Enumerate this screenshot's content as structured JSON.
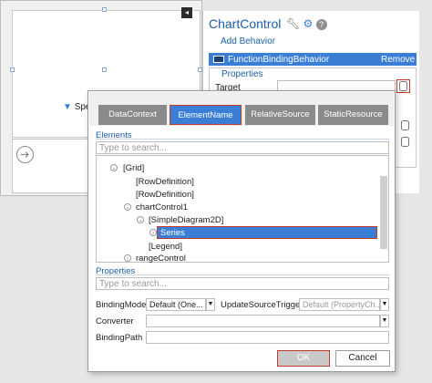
{
  "designer": {
    "legend_label": "Spec",
    "smart_tag_glyph": "◂"
  },
  "panel": {
    "title": "ChartControl",
    "icons": [
      "wrench-icon",
      "gear-icon",
      "help-icon"
    ],
    "help_glyph": "?",
    "add_behavior": "Add Behavior",
    "behavior_name": "FunctionBindingBehavior",
    "remove": "Remove",
    "properties_title": "Properties",
    "target_label": "Target"
  },
  "dialog": {
    "tabs": [
      "DataContext",
      "ElementName",
      "RelativeSource Self",
      "StaticResource"
    ],
    "active_tab": "ElementName",
    "elements_title": "Elements",
    "search_placeholder": "Type to search...",
    "tree": [
      {
        "label": "[Grid]",
        "expander": true
      },
      {
        "label": "[RowDefinition]",
        "expander": false
      },
      {
        "label": "[RowDefinition]",
        "expander": false
      },
      {
        "label": "chartControl1",
        "expander": true
      },
      {
        "label": "[SimpleDiagram2D]",
        "expander": true
      },
      {
        "label": "Series",
        "expander": true,
        "selected": true
      },
      {
        "label": "[Legend]",
        "expander": false
      },
      {
        "label": "rangeControl",
        "expander": true
      }
    ],
    "properties_title": "Properties",
    "props_search_placeholder": "Type to search...",
    "binding_mode_label": "BindingMode",
    "binding_mode_value": "Default (One...",
    "update_trigger_label": "UpdateSourceTrigger",
    "update_trigger_value": "Default (PropertyCh...",
    "converter_label": "Converter",
    "converter_value": "",
    "binding_path_label": "BindingPath",
    "binding_path_value": "",
    "ok": "OK",
    "cancel": "Cancel"
  },
  "colors": {
    "accent": "#3a7fd5",
    "highlight_border": "#c0392b"
  }
}
